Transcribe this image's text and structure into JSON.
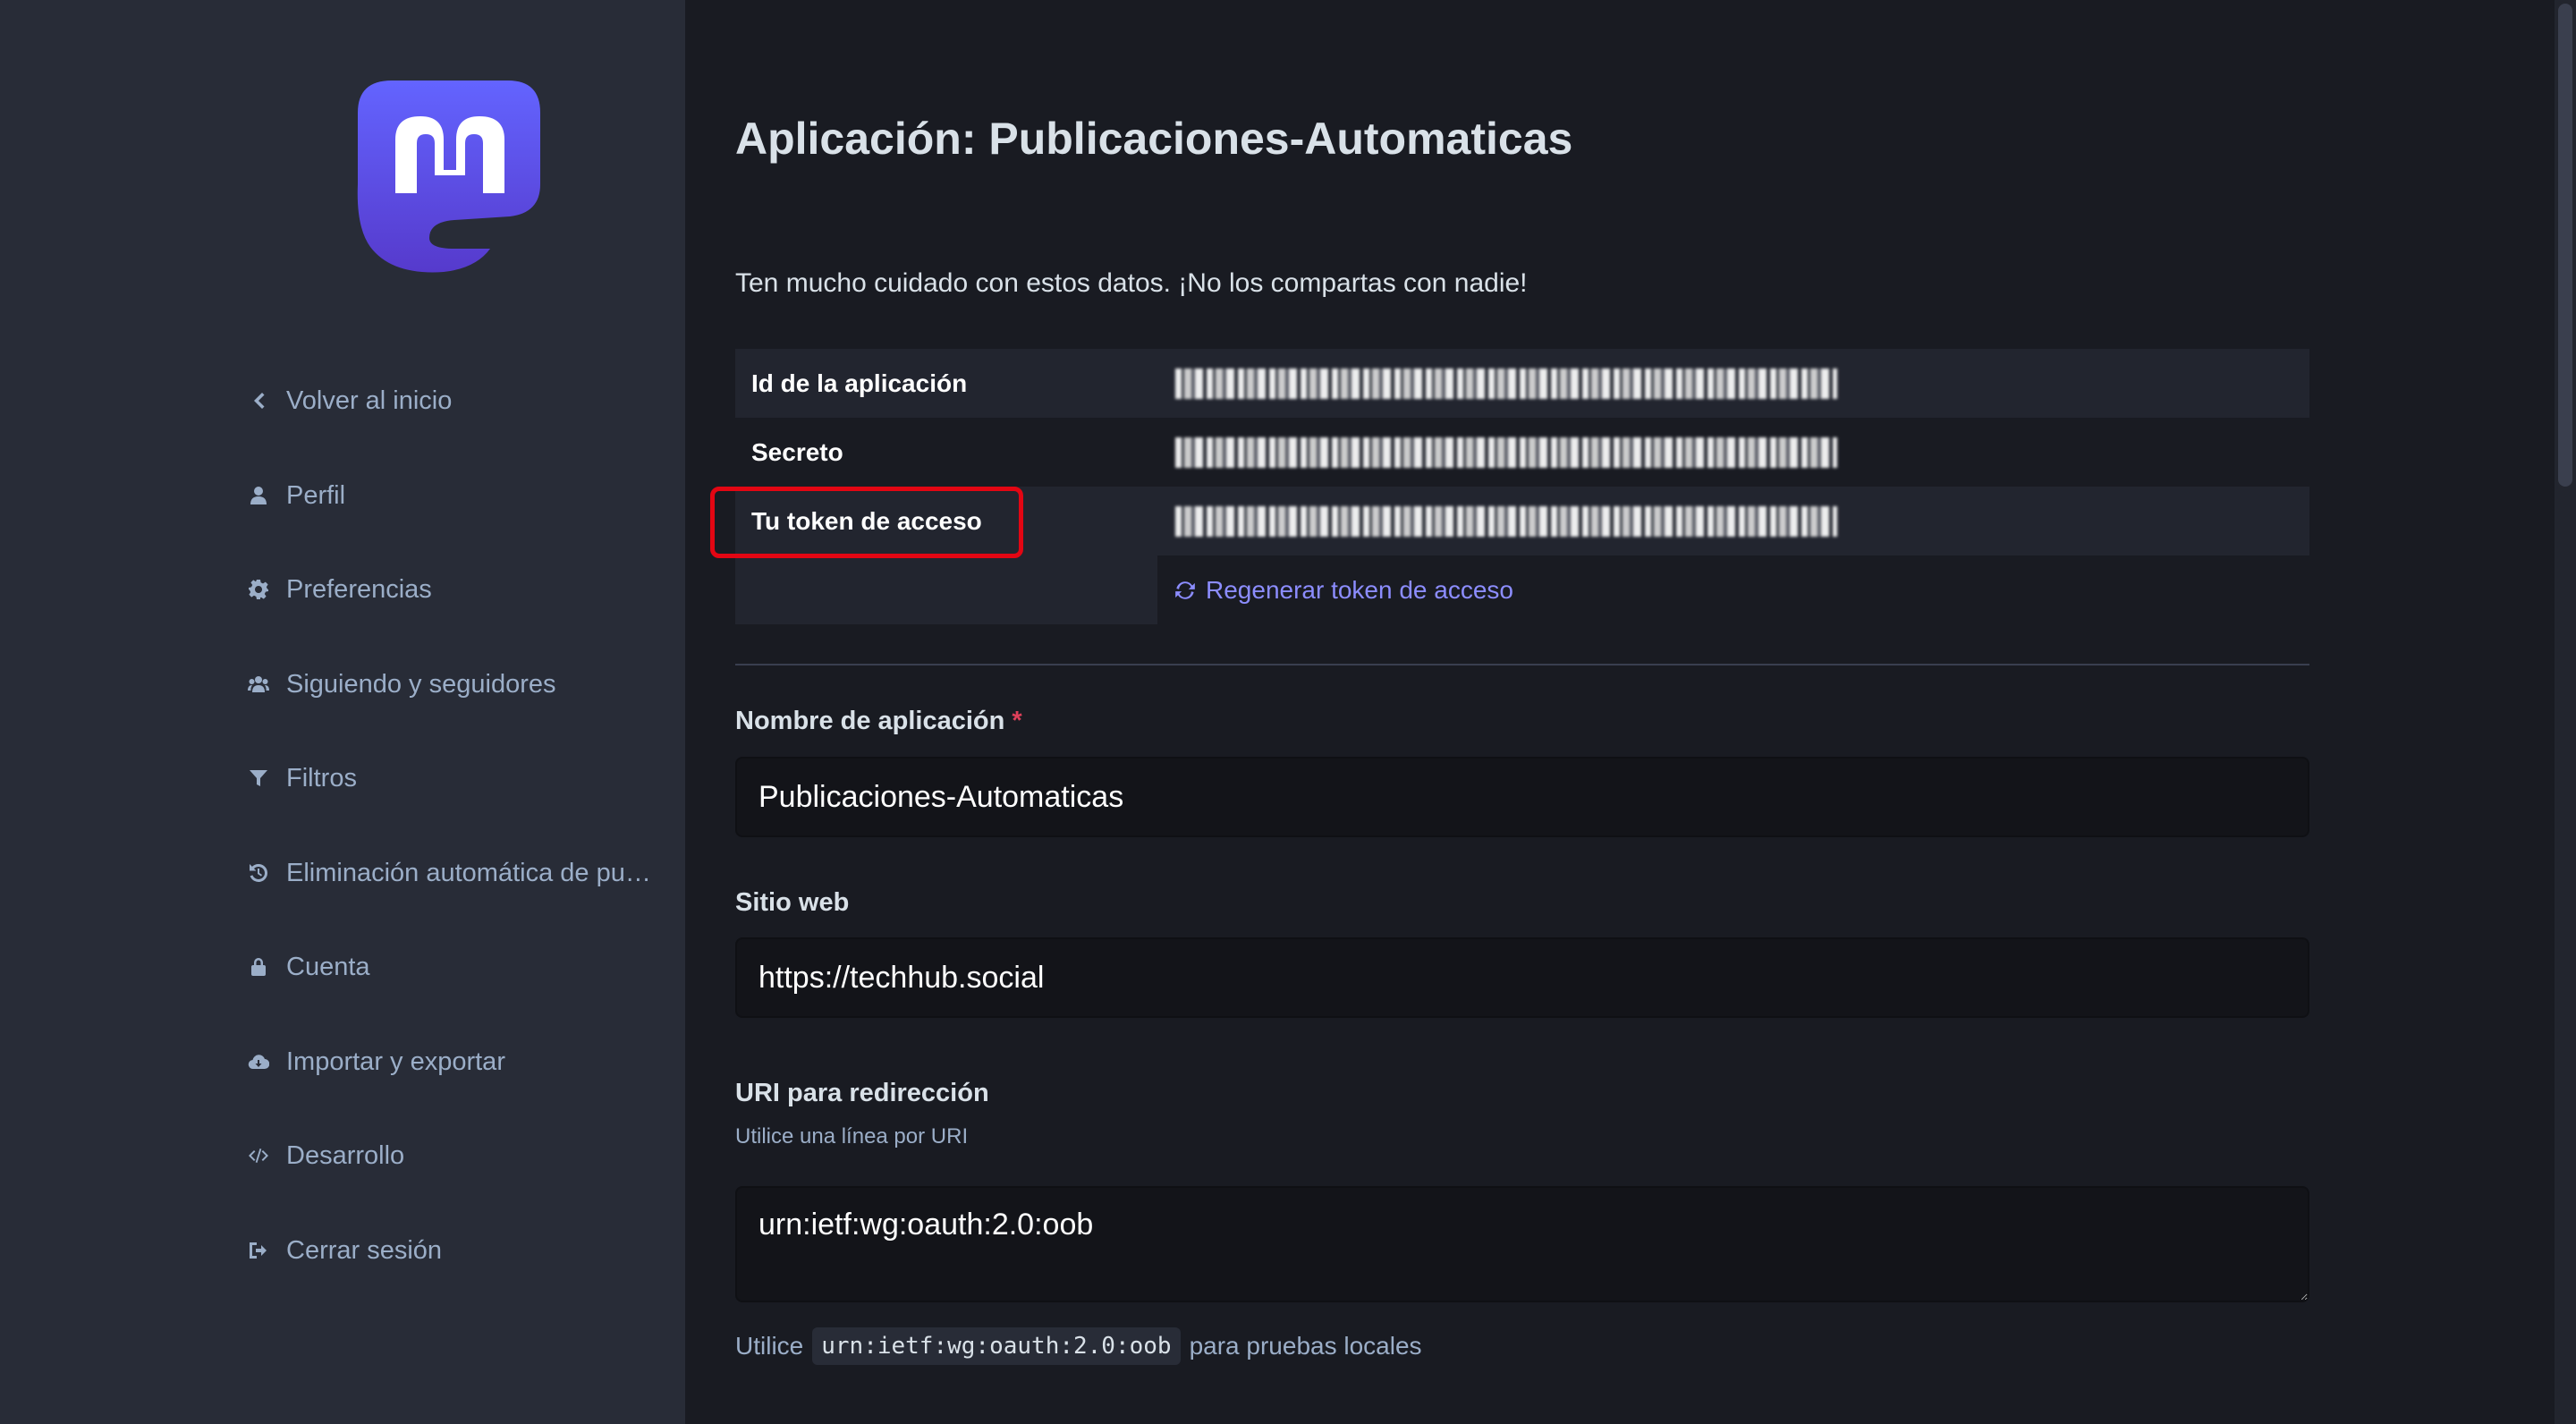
{
  "sidebar": {
    "items": [
      {
        "label": "Volver al inicio",
        "icon": "chevron-left-icon"
      },
      {
        "label": "Perfil",
        "icon": "user-icon"
      },
      {
        "label": "Preferencias",
        "icon": "gear-icon"
      },
      {
        "label": "Siguiendo y seguidores",
        "icon": "users-icon"
      },
      {
        "label": "Filtros",
        "icon": "filter-icon"
      },
      {
        "label": "Eliminación automática de pub…",
        "icon": "history-icon"
      },
      {
        "label": "Cuenta",
        "icon": "lock-icon"
      },
      {
        "label": "Importar y exportar",
        "icon": "cloud-download-icon"
      },
      {
        "label": "Desarrollo",
        "icon": "code-icon"
      },
      {
        "label": "Cerrar sesión",
        "icon": "sign-out-icon"
      }
    ]
  },
  "page": {
    "title": "Aplicación: Publicaciones-Automaticas",
    "warning": "Ten mucho cuidado con estos datos. ¡No los compartas con nadie!"
  },
  "credentials": {
    "client_id_label": "Id de la aplicación",
    "secret_label": "Secreto",
    "token_label": "Tu token de acceso",
    "regenerate_label": "Regenerar token de acceso"
  },
  "form": {
    "name": {
      "label": "Nombre de aplicación",
      "required_mark": "*",
      "value": "Publicaciones-Automaticas"
    },
    "website": {
      "label": "Sitio web",
      "value": "https://techhub.social"
    },
    "redirect": {
      "label": "URI para redirección",
      "hint": "Utilice una línea por URI",
      "value": "urn:ietf:wg:oauth:2.0:oob",
      "footer_prefix": "Utilice",
      "footer_code": "urn:ietf:wg:oauth:2.0:oob",
      "footer_suffix": "para pruebas locales"
    }
  },
  "colors": {
    "accent": "#8c8dff",
    "highlight": "#e30613",
    "logo": "#6364ff"
  }
}
